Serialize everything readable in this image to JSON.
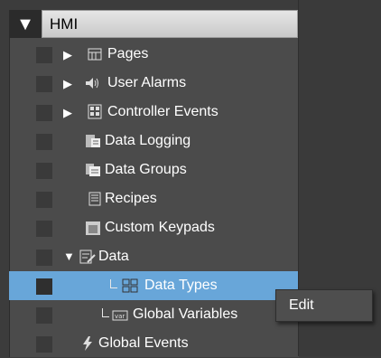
{
  "tree": {
    "root_label": "HMI",
    "items": [
      {
        "label": "Pages",
        "icon": "pages-icon"
      },
      {
        "label": "User Alarms",
        "icon": "speaker-icon"
      },
      {
        "label": "Controller Events",
        "icon": "controller-events-icon"
      },
      {
        "label": "Data Logging",
        "icon": "data-logging-icon"
      },
      {
        "label": "Data Groups",
        "icon": "data-groups-icon"
      },
      {
        "label": "Recipes",
        "icon": "recipes-icon"
      },
      {
        "label": "Custom Keypads",
        "icon": "keypad-icon"
      },
      {
        "label": "Data",
        "icon": "data-icon"
      },
      {
        "label": "Data Types",
        "icon": "data-types-icon"
      },
      {
        "label": "Global Variables",
        "icon": "variables-icon"
      },
      {
        "label": "Global Events",
        "icon": "lightning-icon"
      }
    ]
  },
  "context_menu": {
    "items": [
      {
        "label": "Edit"
      }
    ]
  },
  "colors": {
    "selection": "#68a6d9",
    "panel": "#4b4b4b",
    "header": "#d8d8d8"
  }
}
